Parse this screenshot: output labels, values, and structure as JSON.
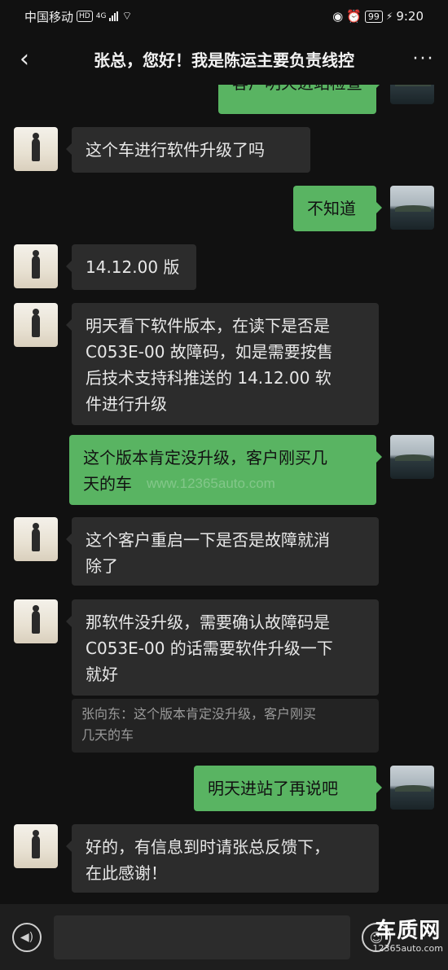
{
  "status_bar": {
    "carrier": "中国移动",
    "hd": "HD",
    "network": "4G",
    "battery": "99",
    "time": "9:20"
  },
  "header": {
    "title": "张总，您好！我是陈运主要负责线控",
    "back_icon": "chevron-left-icon",
    "more_icon": "more-dots-icon"
  },
  "messages": [
    {
      "side": "right",
      "text": "客户明天进站检查"
    },
    {
      "side": "left",
      "text": "这个车进行软件升级了吗"
    },
    {
      "side": "right",
      "text": "不知道"
    },
    {
      "side": "left",
      "text": "14.12.00 版"
    },
    {
      "side": "left",
      "lines": [
        "明天看下软件版本，在读下是否是",
        "C053E-00 故障码，如是需要按售",
        "后技术支持科推送的 14.12.00 软",
        "件进行升级"
      ]
    },
    {
      "side": "right",
      "lines": [
        "这个版本肯定没升级，客户刚买几",
        "天的车"
      ]
    },
    {
      "side": "left",
      "lines": [
        "这个客户重启一下是否是故障就消",
        "除了"
      ]
    },
    {
      "side": "left",
      "lines": [
        "那软件没升级，需要确认故障码是",
        "C053E-00 的话需要软件升级一下",
        "就好"
      ],
      "quote_lines": [
        "张向东：这个版本肯定没升级，客户刚买",
        "几天的车"
      ]
    },
    {
      "side": "right",
      "text": "明天进站了再说吧"
    },
    {
      "side": "left",
      "lines": [
        "好的，有信息到时请张总反馈下，",
        "在此感谢！"
      ]
    }
  ],
  "watermark": "www.12365auto.com",
  "input_bar": {
    "voice_icon": "voice-icon",
    "emoji_icon": "emoji-icon"
  },
  "brand": {
    "name": "车质网",
    "url": "12365auto.com"
  }
}
